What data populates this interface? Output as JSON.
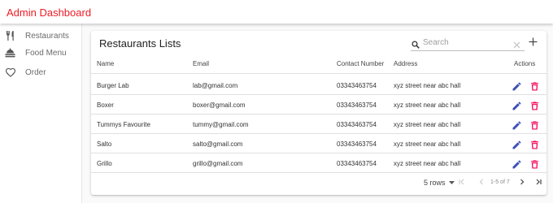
{
  "app": {
    "title": "Admin Dashboard"
  },
  "sidebar": {
    "items": [
      {
        "label": "Restaurants",
        "icon": "fork-knife-icon"
      },
      {
        "label": "Food Menu",
        "icon": "food-tray-icon"
      },
      {
        "label": "Order",
        "icon": "heart-icon"
      }
    ]
  },
  "table": {
    "title": "Restaurants Lists",
    "search_placeholder": "Search",
    "headers": {
      "name": "Name",
      "email": "Email",
      "contact": "Contact Number",
      "address": "Address",
      "actions": "Actions"
    },
    "rows": [
      {
        "name": "Burger Lab",
        "email": "lab@gmail.com",
        "contact": "03343463754",
        "address": "xyz street near abc hall"
      },
      {
        "name": "Boxer",
        "email": "boxer@gmail.com",
        "contact": "03343463754",
        "address": "xyz street near abc hall"
      },
      {
        "name": "Tummys Favourite",
        "email": "tummy@gmail.com",
        "contact": "03343463754",
        "address": "xyz street near abc hall"
      },
      {
        "name": "Salto",
        "email": "salto@gmail.com",
        "contact": "03343463754",
        "address": "xyz street near abc hall"
      },
      {
        "name": "Grillo",
        "email": "grillo@gmail.com",
        "contact": "03343463754",
        "address": "xyz street near abc hall"
      }
    ]
  },
  "pagination": {
    "rows_label": "5 rows",
    "range": "1-5 of 7"
  },
  "colors": {
    "brand": "#ee1c25",
    "edit": "#3f51b5",
    "delete": "#f50057"
  }
}
